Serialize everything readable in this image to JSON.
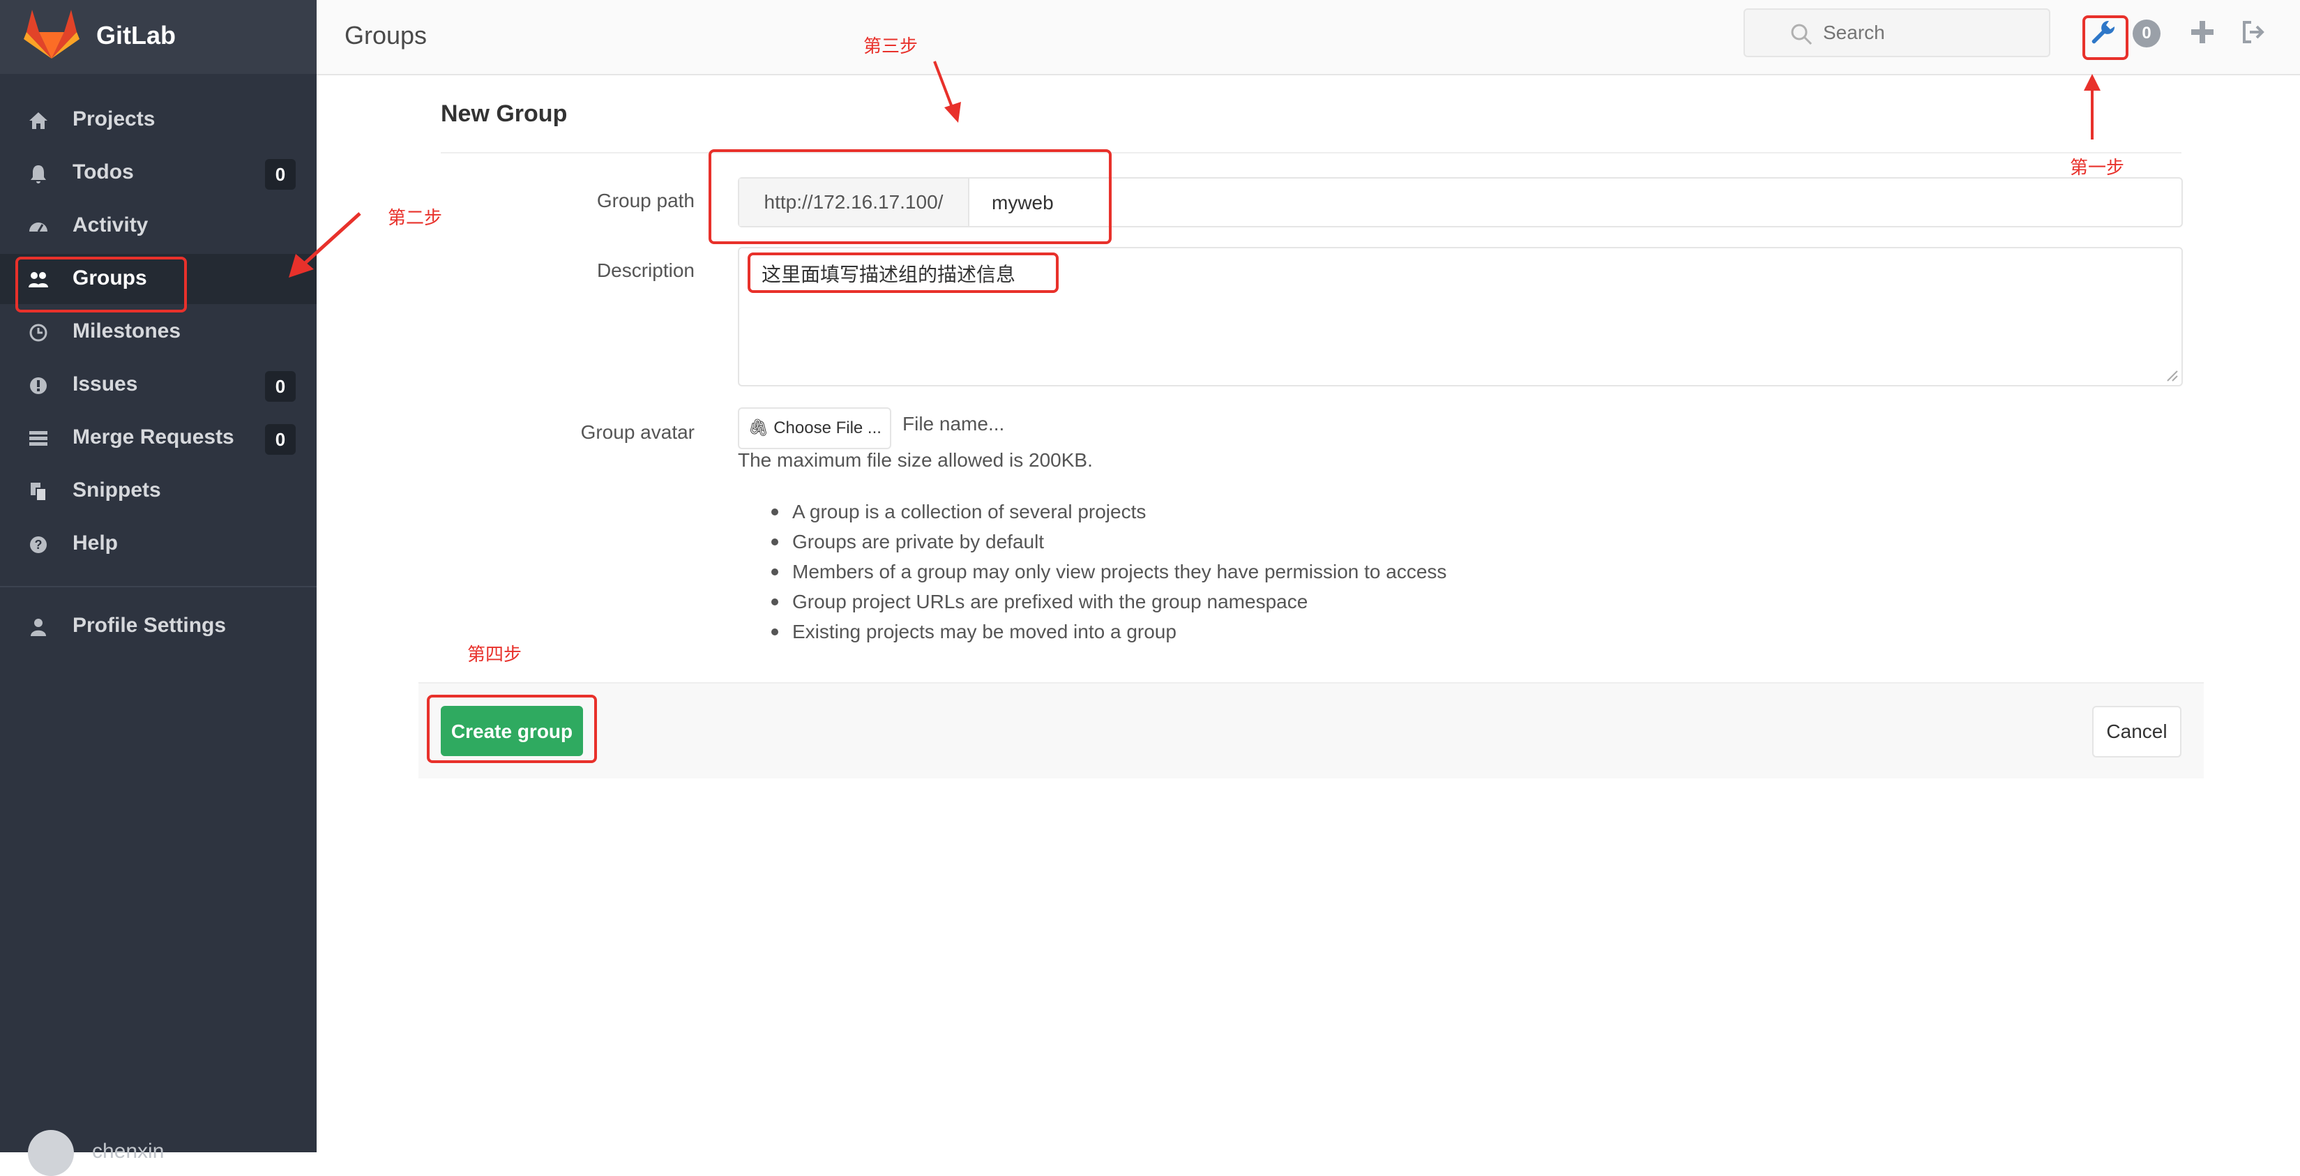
{
  "brand": {
    "name": "GitLab",
    "logo_icon": "gitlab-fox-icon"
  },
  "colors": {
    "sidebar_bg": "#2e3440",
    "accent_green": "#2faa60",
    "annotation_red": "#e8312b"
  },
  "sidebar": {
    "items": [
      {
        "label": "Projects",
        "icon": "home-icon"
      },
      {
        "label": "Todos",
        "icon": "bell-icon",
        "count": "0"
      },
      {
        "label": "Activity",
        "icon": "dashboard-icon"
      },
      {
        "label": "Groups",
        "icon": "users-icon",
        "active": true
      },
      {
        "label": "Milestones",
        "icon": "clock-icon"
      },
      {
        "label": "Issues",
        "icon": "exclamation-circle-icon",
        "count": "0"
      },
      {
        "label": "Merge Requests",
        "icon": "tasks-icon",
        "count": "0"
      },
      {
        "label": "Snippets",
        "icon": "clipboard-icon"
      },
      {
        "label": "Help",
        "icon": "question-circle-icon"
      }
    ],
    "profile": {
      "label": "Profile Settings",
      "icon": "user-icon"
    },
    "user_name": "chenxin"
  },
  "header": {
    "title": "Groups",
    "search_placeholder": "Search",
    "todos_count": "0",
    "icons": [
      "wrench-icon",
      "plus-icon",
      "sign-out-icon"
    ]
  },
  "form": {
    "heading": "New Group",
    "group_path_label": "Group path",
    "path_prefix": "http://172.16.17.100/",
    "path_value": "myweb",
    "description_label": "Description",
    "description_value": "这里面填写描述组的描述信息",
    "avatar_label": "Group avatar",
    "choose_file": "Choose File ...",
    "file_name": "File name...",
    "max_size_help": "The maximum file size allowed is 200KB.",
    "info_bullets": [
      "A group is a collection of several projects",
      "Groups are private by default",
      "Members of a group may only view projects they have permission to access",
      "Group project URLs are prefixed with the group namespace",
      "Existing projects may be moved into a group"
    ],
    "create_button": "Create group",
    "cancel_button": "Cancel"
  },
  "annotations": {
    "step1": "第一步",
    "step2": "第二步",
    "step3": "第三步",
    "step4": "第四步"
  }
}
